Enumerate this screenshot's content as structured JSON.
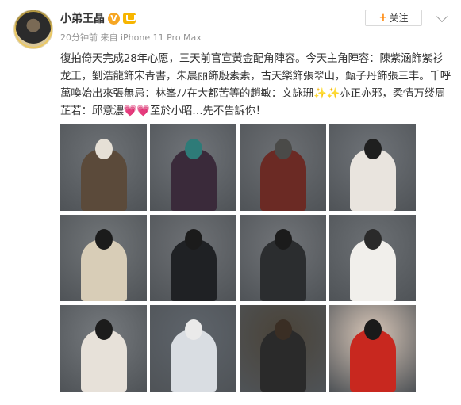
{
  "post": {
    "author": "小弟王晶",
    "verified_mark": "V",
    "meta": "20分钟前 来自 iPhone 11 Pro Max",
    "follow_label": "关注",
    "text": "復拍倚天完成28年心愿，三天前官宣黃金配角陣容。今天主角陣容：陳紫涵飾紫衫龙王，劉浩龍飾宋青書，朱晨丽飾殷素素，古天樂飾張翠山，甄子丹飾張三丰。千呼萬喚始出來張無忌：林峯ﾉﾉ在大都苦等的趙敏：文詠珊✨✨亦正亦邪，柔情万缕周芷若：邱意濃💗💗至於小昭…先不告訴你！"
  },
  "photos": [
    {
      "name": "photo-1",
      "bg": "#6e7276",
      "body": "#5b4a3a",
      "head": "#e6e0d6"
    },
    {
      "name": "photo-2",
      "bg": "#707479",
      "body": "#3a2a3a",
      "head": "#2e7b78"
    },
    {
      "name": "photo-3",
      "bg": "#6c6f73",
      "body": "#6b2a24",
      "head": "#4a4a48"
    },
    {
      "name": "photo-4",
      "bg": "#6f7378",
      "body": "#e9e4de",
      "head": "#1f1f1f"
    },
    {
      "name": "photo-5",
      "bg": "#727679",
      "body": "#d8cdb7",
      "head": "#1b1b1b"
    },
    {
      "name": "photo-6",
      "bg": "#6e7175",
      "body": "#1f2124",
      "head": "#1b1b1b"
    },
    {
      "name": "photo-7",
      "bg": "#717478",
      "body": "#2b2d2f",
      "head": "#1b1b1b"
    },
    {
      "name": "photo-8",
      "bg": "#6c7074",
      "body": "#f1efeb",
      "head": "#2a2a2a"
    },
    {
      "name": "photo-9",
      "bg": "#767a7e",
      "body": "#e7e1d9",
      "head": "#1c1c1c"
    },
    {
      "name": "photo-10",
      "bg": "#5e646b",
      "body": "#d9dde2",
      "head": "#eaeaea"
    },
    {
      "name": "photo-11",
      "bg": "#4a4338",
      "body": "#2a2a2a",
      "head": "#3a2e24"
    },
    {
      "name": "photo-12",
      "bg": "#d9c7b8",
      "body": "#c8281f",
      "head": "#1a1a1a"
    }
  ],
  "icons": {
    "avatar": "avatar-image",
    "verified": "verified-badge-icon",
    "member": "member-badge-icon",
    "plus": "plus-icon",
    "more": "chevron-down-icon"
  }
}
